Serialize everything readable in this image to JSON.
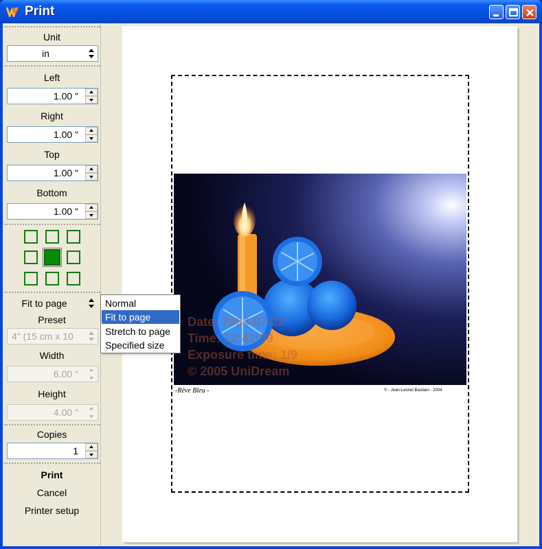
{
  "window": {
    "title": "Print"
  },
  "panel": {
    "unit": {
      "label": "Unit",
      "value": "in"
    },
    "margins": {
      "left": {
        "label": "Left",
        "value": "1.00 \""
      },
      "right": {
        "label": "Right",
        "value": "1.00 \""
      },
      "top": {
        "label": "Top",
        "value": "1.00 \""
      },
      "bottom": {
        "label": "Bottom",
        "value": "1.00 \""
      }
    },
    "position": {
      "selected": "center"
    },
    "scaling": {
      "value": "Fit to page"
    },
    "preset": {
      "label": "Preset",
      "value": "4\" (15 cm x 10"
    },
    "width": {
      "label": "Width",
      "value": "6.00 \""
    },
    "height": {
      "label": "Height",
      "value": "4.00 \""
    },
    "copies": {
      "label": "Copies",
      "value": "1"
    },
    "actions": {
      "print": "Print",
      "cancel": "Cancel",
      "setup": "Printer setup"
    }
  },
  "dropdown": {
    "options": [
      "Normal",
      "Fit to page",
      "Stretch to page",
      "Specified size"
    ],
    "selected": "Fit to page"
  },
  "photo": {
    "overlay_lines": [
      "Date: 2004-07-22",
      "Time: 12:41:09",
      "Exposure time: 1/9",
      "© 2005 UniDream"
    ],
    "signature": "-Rêve Bleu -",
    "credit": "© - Jean-Leonel Bastiani - 2004"
  },
  "colors": {
    "title_bar": "#0550e0",
    "selection": "#316ac5",
    "position_active": "#0a8a0a"
  }
}
